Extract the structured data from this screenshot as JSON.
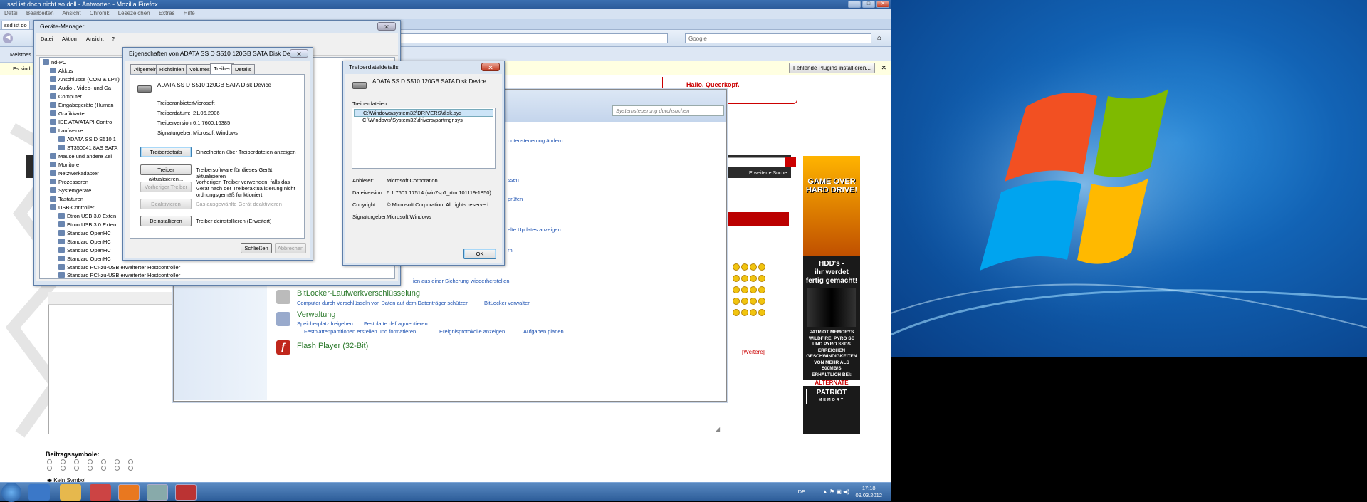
{
  "firefox": {
    "title": "ssd ist doch nicht so doll - Antworten - Mozilla Firefox",
    "menu": [
      "Datei",
      "Bearbeiten",
      "Ansicht",
      "Chronik",
      "Lesezeichen",
      "Extras",
      "Hilfe"
    ],
    "tab_label": "ssd ist do",
    "search_placeholder": "Google",
    "bookmark_label": "Meistbes",
    "notice_label": "Es sind",
    "plugin_button": "Fehlende Plugins installieren..."
  },
  "forum": {
    "greeting": "Hallo, Queerkopf.",
    "advanced_search": "Erweiterte Suche",
    "more_link": "[Weitere]",
    "beitrag_symbole": "Beitragssymbole:",
    "kein_symbol": "Kein Symbol"
  },
  "ad": {
    "lines": [
      "GAME OVER",
      "HARD DRIVE!",
      "HDD's -",
      "ihr werdet",
      "fertig gemacht!",
      "PATRIOT MEMORYS",
      "WILDFIRE, PYRO SE",
      "UND PYRO SSDS",
      "ERREICHEN",
      "GESCHWINDIGKEITEN",
      "VON MEHR ALS",
      "500MB/S",
      "ERHÄLTLICH BEI:",
      "ALTERNATE",
      "PATRIOT",
      "MEMORY"
    ]
  },
  "control_panel": {
    "search_placeholder": "Systemsteuerung durchsuchen",
    "links_partial": [
      "ontensteuerung ändern",
      "ssen",
      "prüfen",
      "elte Updates anzeigen",
      "rn",
      "ien aus einer Sicherung wiederherstellen"
    ],
    "sections": [
      {
        "title": "BitLocker-Laufwerkverschlüsselung",
        "links": [
          "Computer durch Verschlüsseln von Daten auf dem Datenträger schützen",
          "BitLocker verwalten"
        ]
      },
      {
        "title": "Verwaltung",
        "links": [
          "Speicherplatz freigeben",
          "Festplatte defragmentieren",
          "Festplattenpartitionen erstellen und formatieren",
          "Ereignisprotokolle anzeigen",
          "Aufgaben planen"
        ]
      },
      {
        "title": "Flash Player (32-Bit)",
        "links": []
      }
    ]
  },
  "device_manager": {
    "title": "Geräte-Manager",
    "menu": [
      "Datei",
      "Aktion",
      "Ansicht",
      "?"
    ],
    "tree": [
      "nd-PC",
      "Akkus",
      "Anschlüsse (COM & LPT)",
      "Audio-, Video- und Ga",
      "Computer",
      "Eingabegeräte (Human",
      "Grafikkarte",
      "IDE ATA/ATAPI-Contro",
      "Laufwerke",
      "ADATA SS D S510 1",
      "ST350041 8AS SATA",
      "Mäuse und andere Zei",
      "Monitore",
      "Netzwerkadapter",
      "Prozessoren",
      "Systemgeräte",
      "Tastaturen",
      "USB-Controller",
      "Etron USB 3.0 Exten",
      "Etron USB 3.0 Exten",
      "Standard OpenHC",
      "Standard OpenHC",
      "Standard OpenHC",
      "Standard OpenHC",
      "Standard PCI-zu-USB erweiterter Hostcontroller",
      "Standard PCI-zu-USB erweiterter Hostcontroller"
    ]
  },
  "properties": {
    "title": "Eigenschaften von ADATA SS D S510 120GB SATA Disk Device",
    "tabs": [
      "Allgemein",
      "Richtlinien",
      "Volumes",
      "Treiber",
      "Details"
    ],
    "device_name": "ADATA SS D S510 120GB SATA Disk Device",
    "fields": [
      {
        "label": "Treiberanbieter:",
        "value": "Microsoft"
      },
      {
        "label": "Treiberdatum:",
        "value": "21.06.2006"
      },
      {
        "label": "Treiberversion:",
        "value": "6.1.7600.16385"
      },
      {
        "label": "Signaturgeber:",
        "value": "Microsoft Windows"
      }
    ],
    "actions": [
      {
        "button": "Treiberdetails",
        "desc": "Einzelheiten über Treiberdateien anzeigen"
      },
      {
        "button": "Treiber aktualisieren...",
        "desc": "Treibersoftware für dieses Gerät aktualisieren"
      },
      {
        "button": "Vorheriger Treiber",
        "desc": "Vorherigen Treiber verwenden, falls das Gerät nach der Treiberaktualisierung nicht ordnungsgemäß funktioniert."
      },
      {
        "button": "Deaktivieren",
        "desc": "Das ausgewählte Gerät deaktivieren"
      },
      {
        "button": "Deinstallieren",
        "desc": "Treiber deinstallieren (Erweitert)"
      }
    ],
    "ok": "Schließen",
    "cancel": "Abbrechen"
  },
  "driver_details": {
    "title": "Treiberdateidetails",
    "device_name": "ADATA SS D S510 120GB SATA Disk Device",
    "files_label": "Treiberdateien:",
    "files": [
      "C:\\Windows\\system32\\DRIVERS\\disk.sys",
      "C:\\Windows\\System32\\drivers\\partmgr.sys"
    ],
    "fields": [
      {
        "label": "Anbieter:",
        "value": "Microsoft Corporation"
      },
      {
        "label": "Dateiversion:",
        "value": "6.1.7601.17514 (win7sp1_rtm.101119-1850)"
      },
      {
        "label": "Copyright:",
        "value": "© Microsoft Corporation. All rights reserved."
      },
      {
        "label": "Signaturgeber:",
        "value": "Microsoft Windows"
      }
    ],
    "ok": "OK"
  },
  "taskbar": {
    "lang": "DE",
    "time": "17:18",
    "date": "09.03.2012"
  },
  "colors": {
    "accent": "#c00000",
    "link": "#1a4fb0",
    "taskbar": "#2c5c98"
  }
}
